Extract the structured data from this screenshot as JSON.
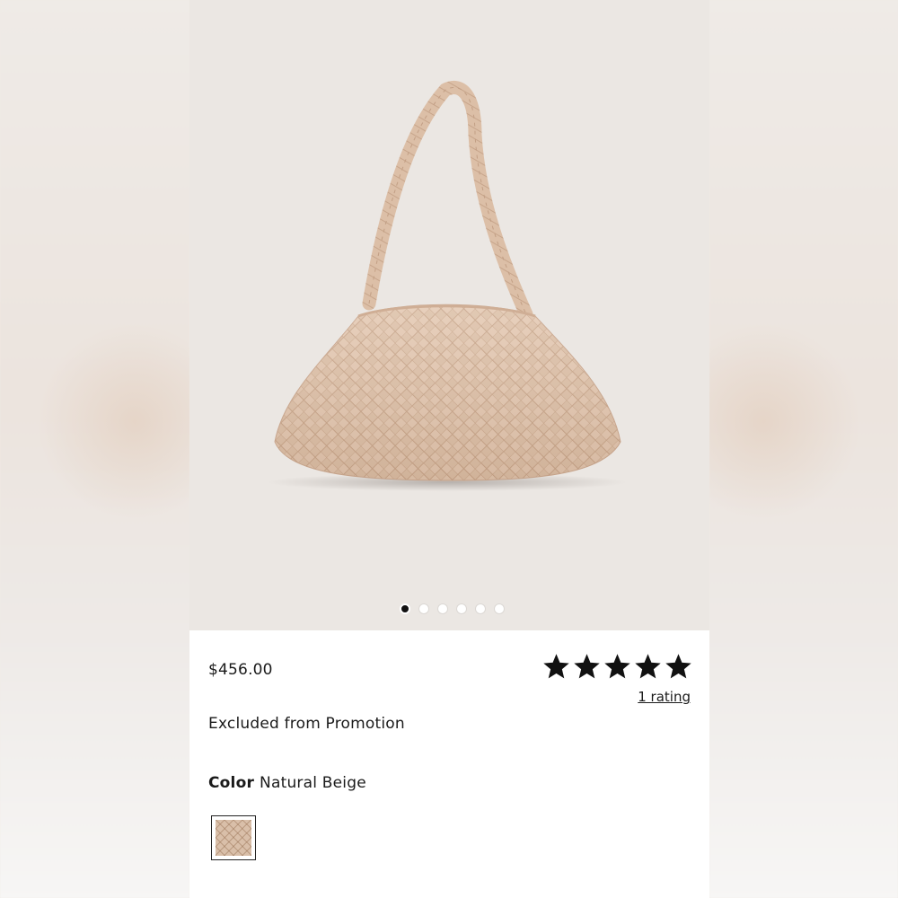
{
  "product": {
    "image_alt": "Woven leather shoulder bag",
    "image_count": 6,
    "active_image_index": 0,
    "price": "$456.00",
    "rating": {
      "stars": 5,
      "max_stars": 5,
      "count_label": "1 rating"
    },
    "promo_note": "Excluded from Promotion",
    "color": {
      "label": "Color",
      "value": "Natural Beige",
      "swatch_color": "#d9bfa9"
    }
  },
  "colors": {
    "hero_bg": "#ebe7e3",
    "bag": "#e3c7b0",
    "bag_shade": "#c9a68d",
    "star": "#111111"
  },
  "icons": {
    "star": "star-icon"
  }
}
